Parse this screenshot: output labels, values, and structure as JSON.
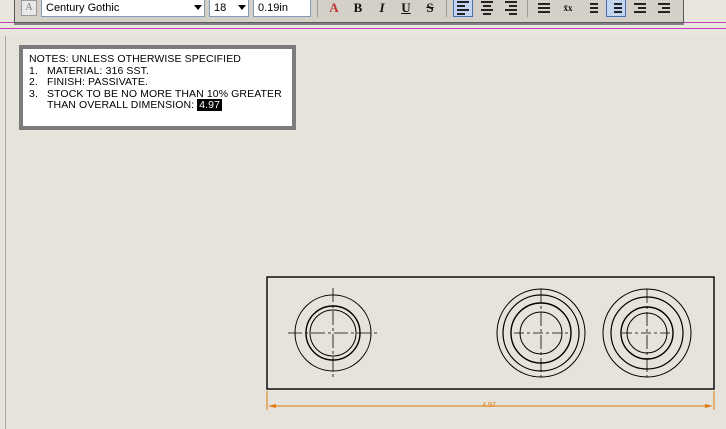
{
  "toolbar": {
    "font_name": "Century Gothic",
    "font_size": "18",
    "char_height": "0.19in",
    "buttons": {
      "color": "A",
      "bold": "B",
      "italic": "I",
      "underline": "U",
      "strike": "S"
    }
  },
  "notes": {
    "heading": "NOTES:  UNLESS OTHERWISE SPECIFIED",
    "items": [
      {
        "num": "1.",
        "text": "MATERIAL: 316 SST."
      },
      {
        "num": "2.",
        "text": "FINISH: PASSIVATE."
      },
      {
        "num": "3.",
        "text": "STOCK TO BE NO MORE THAN 10% GREATER"
      }
    ],
    "continuation": "THAN OVERALL DIMENSION:",
    "highlighted_value": "4.97"
  },
  "drawing": {
    "dimension_label": "4.97",
    "dimension_color": "#e07a10"
  }
}
